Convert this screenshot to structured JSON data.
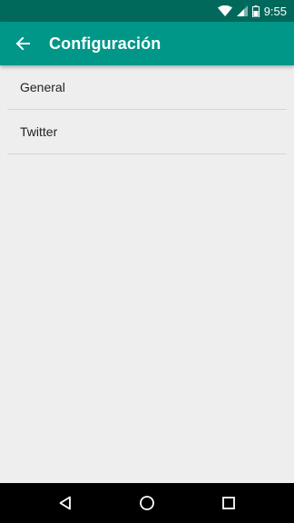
{
  "status_bar": {
    "time": "9:55",
    "icons": [
      "wifi-icon",
      "cell-signal-icon",
      "battery-icon"
    ]
  },
  "app_bar": {
    "title": "Configuración",
    "nav_icon": "arrow-back-icon",
    "color": "#009688",
    "status_color": "#00695c"
  },
  "settings": {
    "items": [
      {
        "label": "General"
      },
      {
        "label": "Twitter"
      }
    ]
  },
  "nav_bar": {
    "buttons": [
      "back-triangle-icon",
      "home-circle-icon",
      "recents-square-icon"
    ]
  }
}
